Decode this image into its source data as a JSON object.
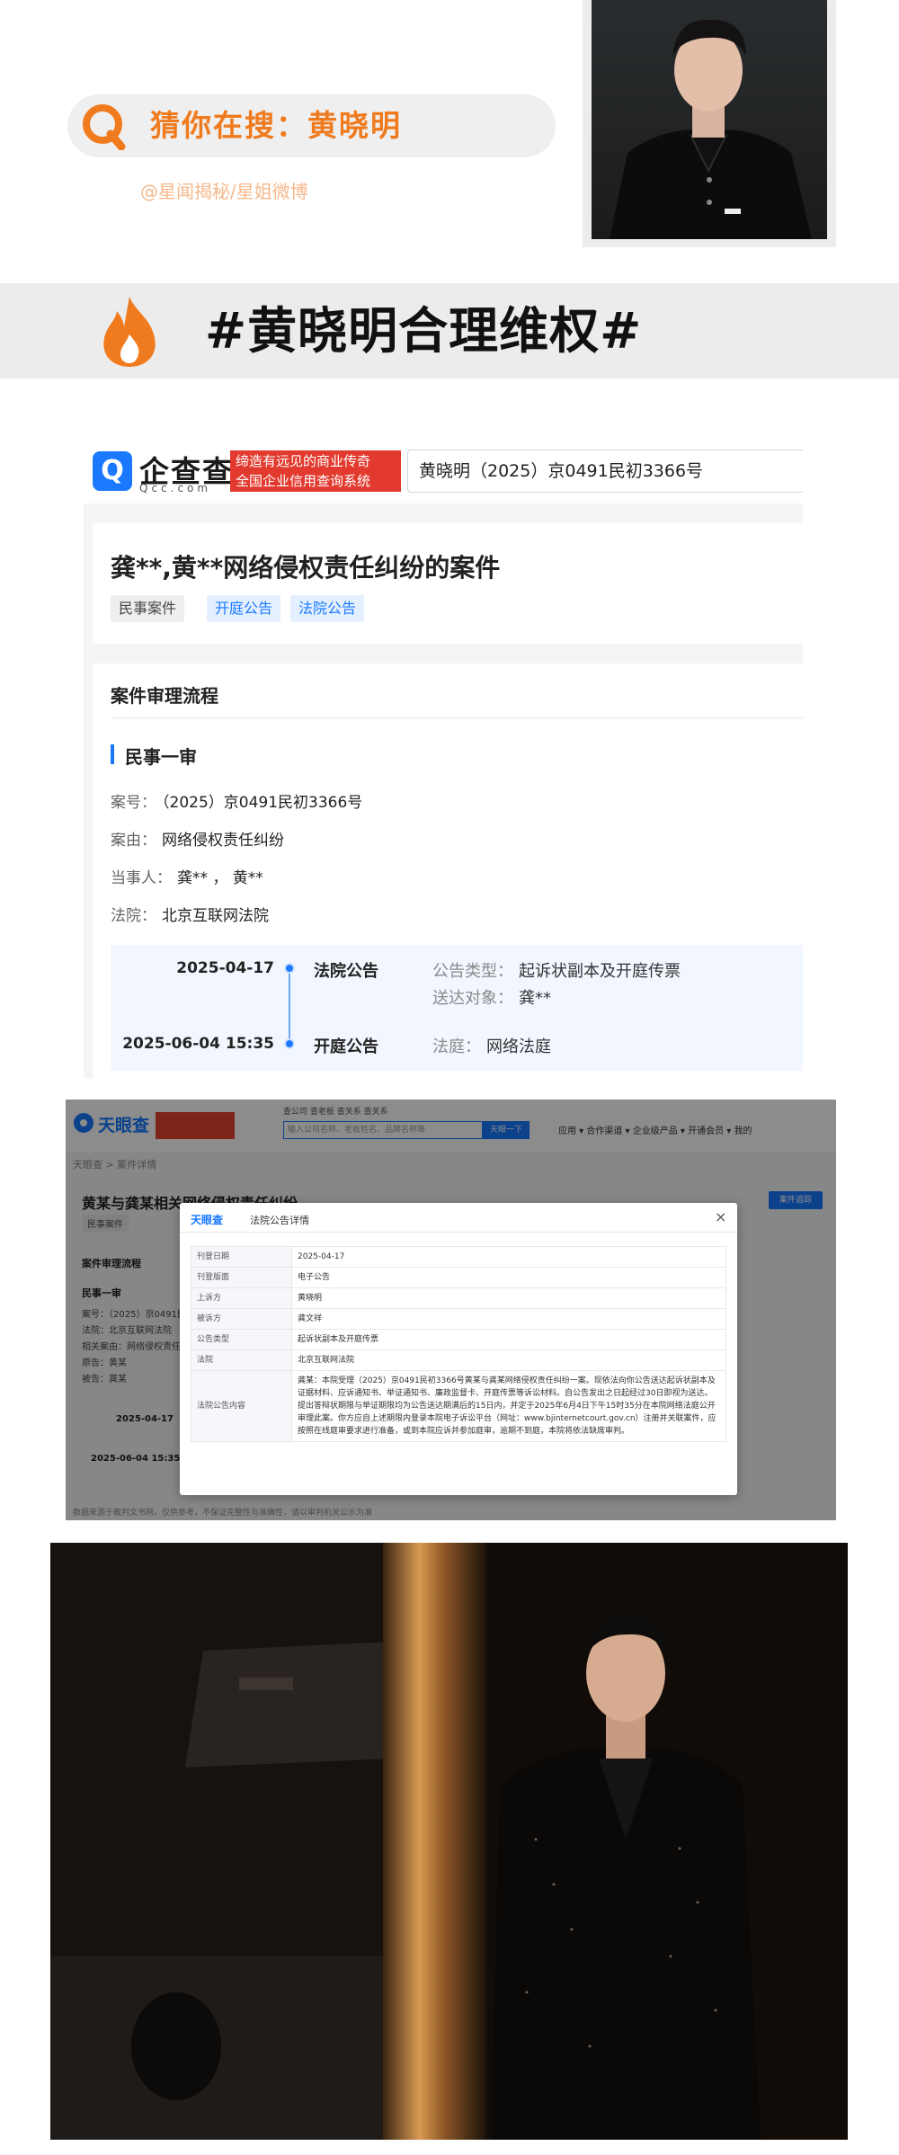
{
  "header": {
    "search_text": "猜你在搜：黄晓明",
    "credit": "@星闻揭秘/星姐微博"
  },
  "banner": {
    "title": "#黄晓明合理维权#"
  },
  "qichacha": {
    "logo_name": "企查查",
    "logo_domain": "Qcc.com",
    "slogan_line1": "缔造有远见的商业传奇",
    "slogan_line2": "全国企业信用查询系统",
    "search_value": "黄晓明（2025）京0491民初3366号",
    "case_title": "龚**,黄**网络侵权责任纠纷的案件",
    "tags": [
      "民事案件",
      "开庭公告",
      "法院公告"
    ],
    "flow_title": "案件审理流程",
    "stage_title": "民事一审",
    "fields": [
      {
        "label": "案号：",
        "value": "（2025）京0491民初3366号"
      },
      {
        "label": "案由：",
        "value": "网络侵权责任纠纷"
      },
      {
        "label": "当事人：",
        "value": "龚** ，  黄**"
      },
      {
        "label": "法院：",
        "value": "北京互联网法院"
      }
    ],
    "timeline": [
      {
        "date": "2025-04-17",
        "type": "法院公告",
        "k1": "公告类型：",
        "v1": "起诉状副本及开庭传票",
        "k2": "送达对象：",
        "v2": "龚**"
      },
      {
        "date": "2025-06-04 15:35",
        "type": "开庭公告",
        "k1": "法庭：",
        "v1": "网络法庭"
      }
    ]
  },
  "tianyancha": {
    "logo": "天眼查",
    "tabs": "查公司  查老板  查关系  查关系",
    "search_placeholder": "输入公司名称、老板姓名、品牌名称等",
    "search_button": "天眼一下",
    "nav": "应用 ▾   合作渠道 ▾   企业级产品 ▾   开通会员 ▾   我的",
    "breadcrumb": "天眼查  >  案件详情",
    "page_title": "黄某与龚某相关网络侵权责任纠纷",
    "badge": "民事案件",
    "right_button": "案件追踪",
    "flow_title": "案件审理流程",
    "stage": "民事一审",
    "rows": [
      "案号：（2025）京0491民",
      "法院：北京互联网法院",
      "相关案由：网络侵权责任纠",
      "原告：黄某",
      "被告：龚某"
    ],
    "date1": "2025-04-17",
    "date2": "2025-06-04 15:35",
    "footer": "数据来源于裁判文书网，仅供参考，不保证完整性与准确性，请以审判机关公示为准",
    "modal": {
      "logo": "天眼查",
      "title": "法院公告详情",
      "close": "×",
      "rows": [
        {
          "k": "刊登日期",
          "v": "2025-04-17"
        },
        {
          "k": "刊登版面",
          "v": "电子公告"
        },
        {
          "k": "上诉方",
          "v": "黄晓明"
        },
        {
          "k": "被诉方",
          "v": "龚文祥"
        },
        {
          "k": "公告类型",
          "v": "起诉状副本及开庭传票"
        },
        {
          "k": "法院",
          "v": "北京互联网法院"
        },
        {
          "k": "法院公告内容",
          "v": "龚某：本院受理（2025）京0491民初3366号黄某与龚某网络侵权责任纠纷一案。现依法向你公告送达起诉状副本及证据材料、应诉通知书、举证通知书、廉政监督卡、开庭传票等诉讼材料。自公告发出之日起经过30日即视为送达。提出答辩状期限与举证期限均为公告送达期满后的15日内，并定于2025年6月4日下午15时35分在本院网络法庭公开审理此案。你方应自上述期限内登录本院电子诉讼平台（网址：www.bjinternetcourt.gov.cn）注册并关联案件，应按照在线庭审要求进行准备，或到本院应诉并参加庭审，逾期不到庭，本院将依法缺席审判。"
        }
      ]
    }
  },
  "colors": {
    "orange": "#f07b1e",
    "credit": "#f6b88c",
    "qcc_blue": "#1b79ff",
    "qcc_red": "#e23a2e",
    "tyc_blue": "#1677ff"
  }
}
